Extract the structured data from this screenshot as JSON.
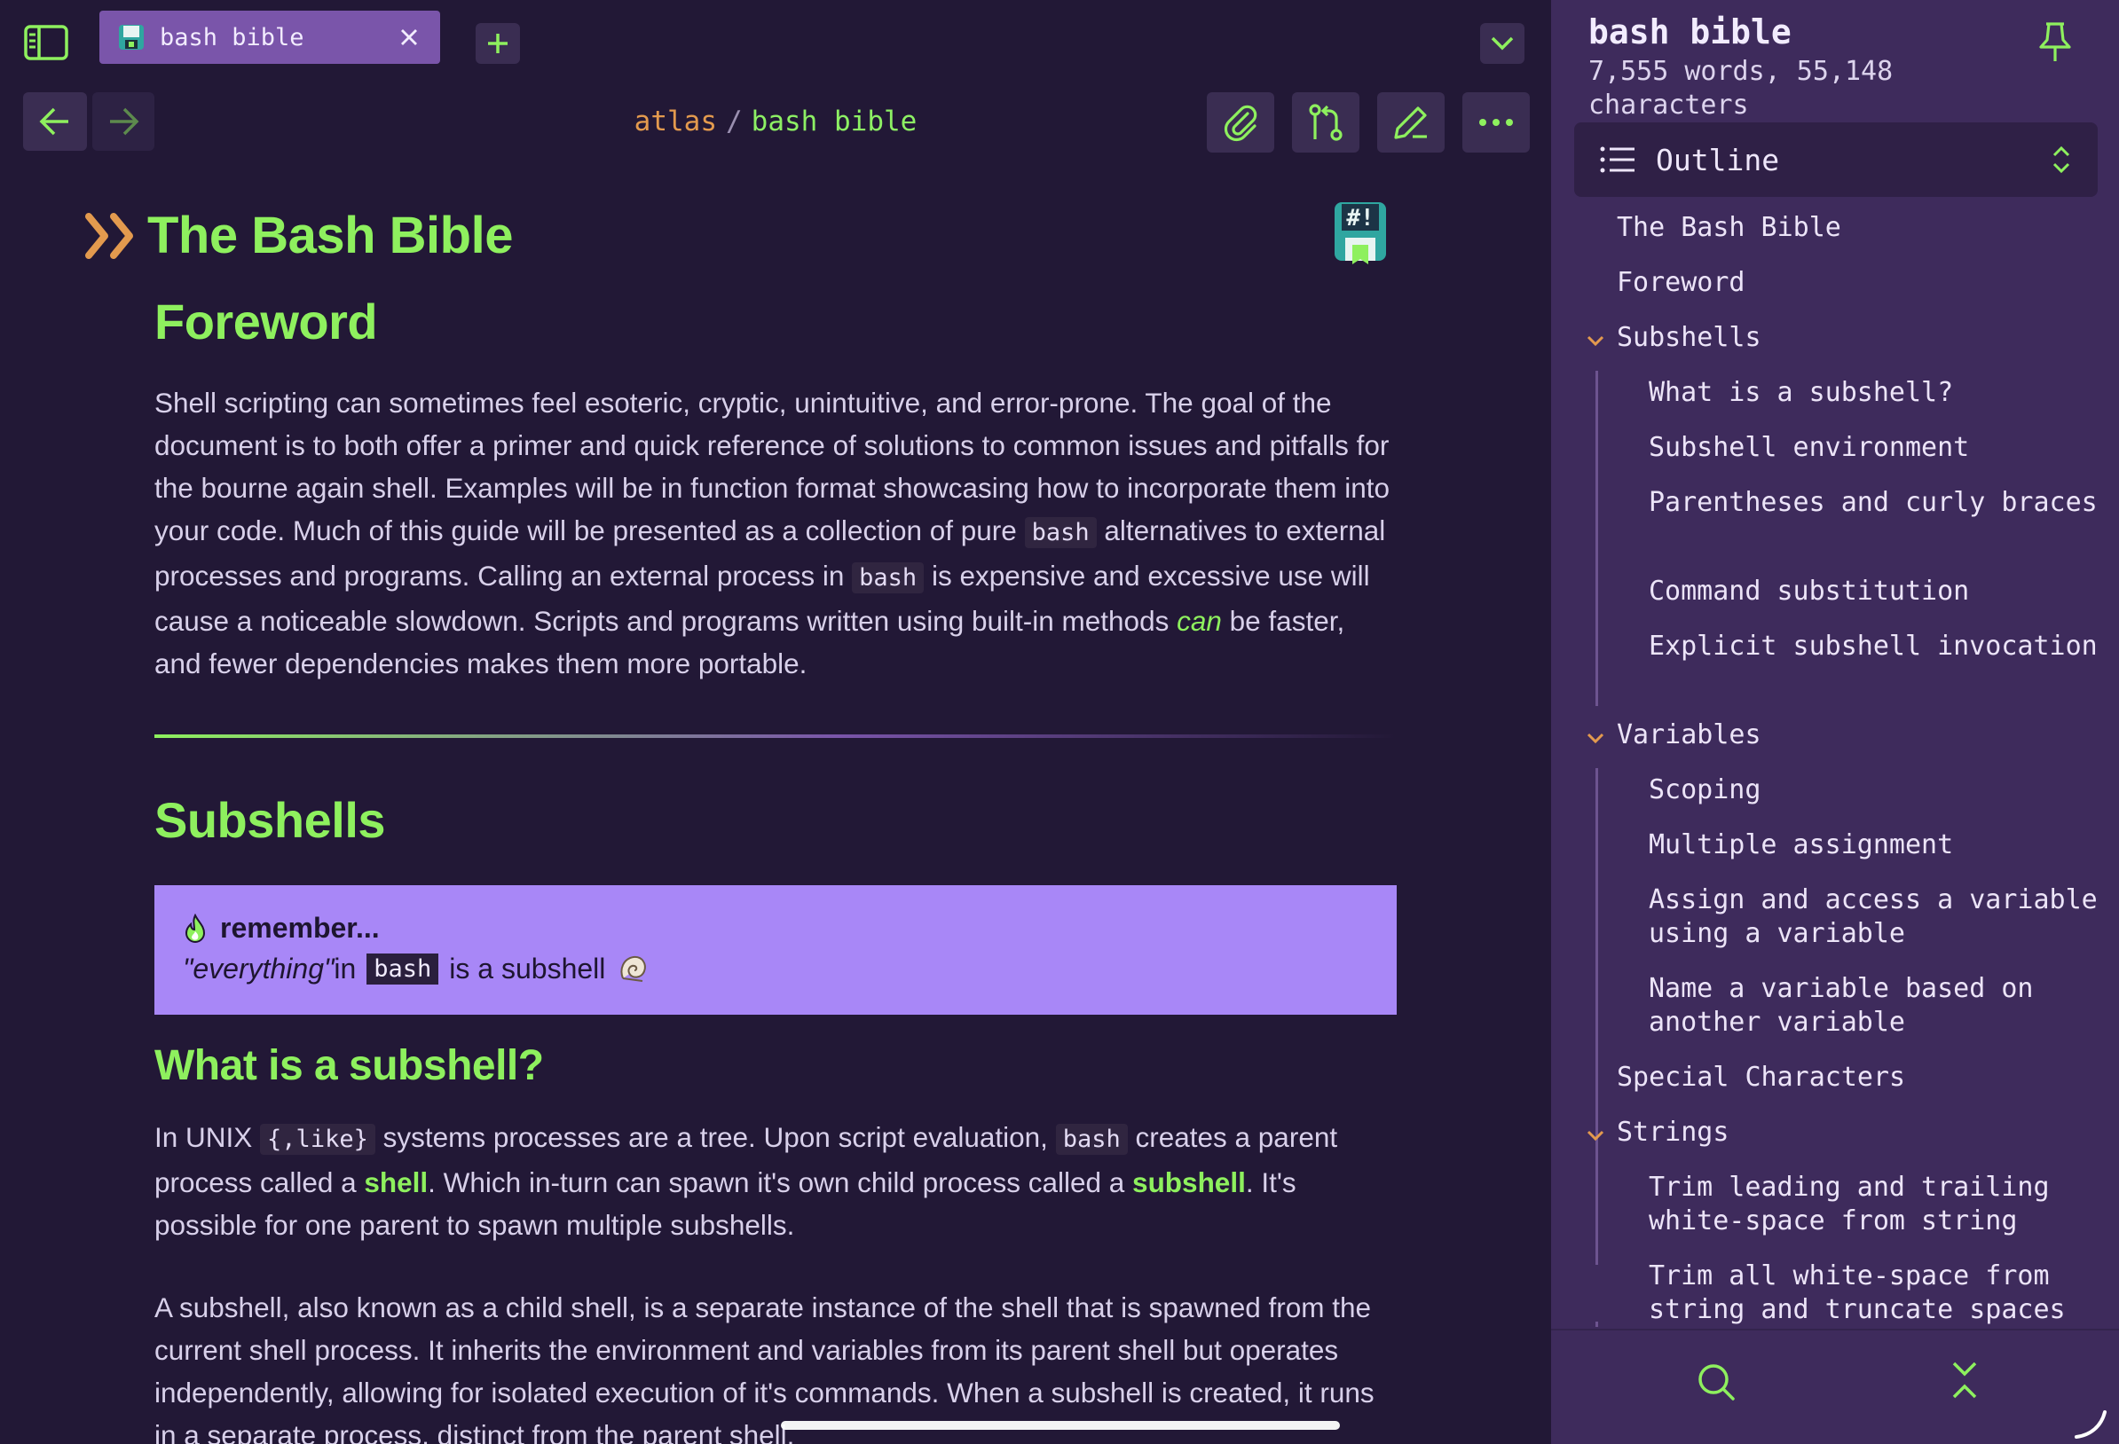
{
  "tabs": [
    {
      "label": "bash bible",
      "icon": "floppy-disk-icon",
      "active": true
    }
  ],
  "breadcrumb": {
    "parent": "atlas",
    "separator": "/",
    "current": "bash bible"
  },
  "document": {
    "title": "The Bash Bible",
    "foreword": {
      "heading": "Foreword",
      "paragraph": {
        "t1": "Shell scripting can sometimes feel esoteric, cryptic, unintuitive, and error-prone. The goal of the document is to both offer a primer and quick reference of solutions to common issues and pitfalls for the bourne again shell. Examples will be in function format showcasing how to incorporate them into your code. Much of this guide will be presented as a collection of pure ",
        "code1": "bash",
        "t2": " alternatives to external processes and programs. Calling an external process in ",
        "code2": "bash",
        "t3": " is expensive and excessive use will cause a noticeable slowdown. Scripts and programs written using built-in methods ",
        "emphasis": "can",
        "t4": " be faster, and fewer dependencies makes them more portable."
      }
    },
    "subshells": {
      "heading": "Subshells",
      "callout": {
        "title": "remember...",
        "quote": "\"everything\"",
        "t1": " in",
        "code": "bash",
        "t2": "is a subshell"
      },
      "what_is": {
        "heading": "What is a subshell?",
        "p1": {
          "t1": "In UNIX ",
          "code1": "{,like}",
          "t2": " systems processes are a tree. Upon script evaluation, ",
          "code2": "bash",
          "t3": " creates a parent process called a ",
          "bold1": "shell",
          "t4": ". Which in-turn can spawn it's own child process called a ",
          "bold2": "subshell",
          "t5": ". It's possible for one parent to spawn multiple subshells."
        },
        "p2": "A subshell, also known as a child shell, is a separate instance of the shell that is spawned from the current shell process. It inherits the environment and variables from its parent shell but operates independently, allowing for isolated execution of it's commands. When a subshell is created, it runs in a separate process, distinct from the parent shell."
      }
    }
  },
  "panel": {
    "title": "bash bible",
    "stats": "7,555 words, 55,148 characters",
    "view_selector": "Outline",
    "outline": [
      {
        "label": "The Bash Bible",
        "level": 0
      },
      {
        "label": "Foreword",
        "level": 0
      },
      {
        "label": "Subshells",
        "level": 0,
        "expanded": true
      },
      {
        "label": "What is a subshell?",
        "level": 1
      },
      {
        "label": "Subshell environment",
        "level": 1
      },
      {
        "label": "Parentheses and curly braces",
        "level": 1
      },
      {
        "label": "Command substitution",
        "level": 1
      },
      {
        "label": "Explicit subshell invocation",
        "level": 1
      },
      {
        "label": "Variables",
        "level": 0,
        "expanded": true
      },
      {
        "label": "Scoping",
        "level": 1
      },
      {
        "label": "Multiple assignment",
        "level": 1
      },
      {
        "label": "Assign and access a variable using a variable",
        "level": 1
      },
      {
        "label": "Name a variable based on another variable",
        "level": 1
      },
      {
        "label": "Special Characters",
        "level": 0
      },
      {
        "label": "Strings",
        "level": 0,
        "expanded": true
      },
      {
        "label": "Trim leading and trailing white-space from string",
        "level": 1
      },
      {
        "label": "Trim all white-space from string and truncate spaces",
        "level": 1
      }
    ]
  },
  "colors": {
    "background": "#221836",
    "panel": "#3e2b5c",
    "accent_green": "#8ef05e",
    "accent_orange": "#e39a4e",
    "tab_active": "#7a55aa",
    "callout": "#a887f7"
  }
}
